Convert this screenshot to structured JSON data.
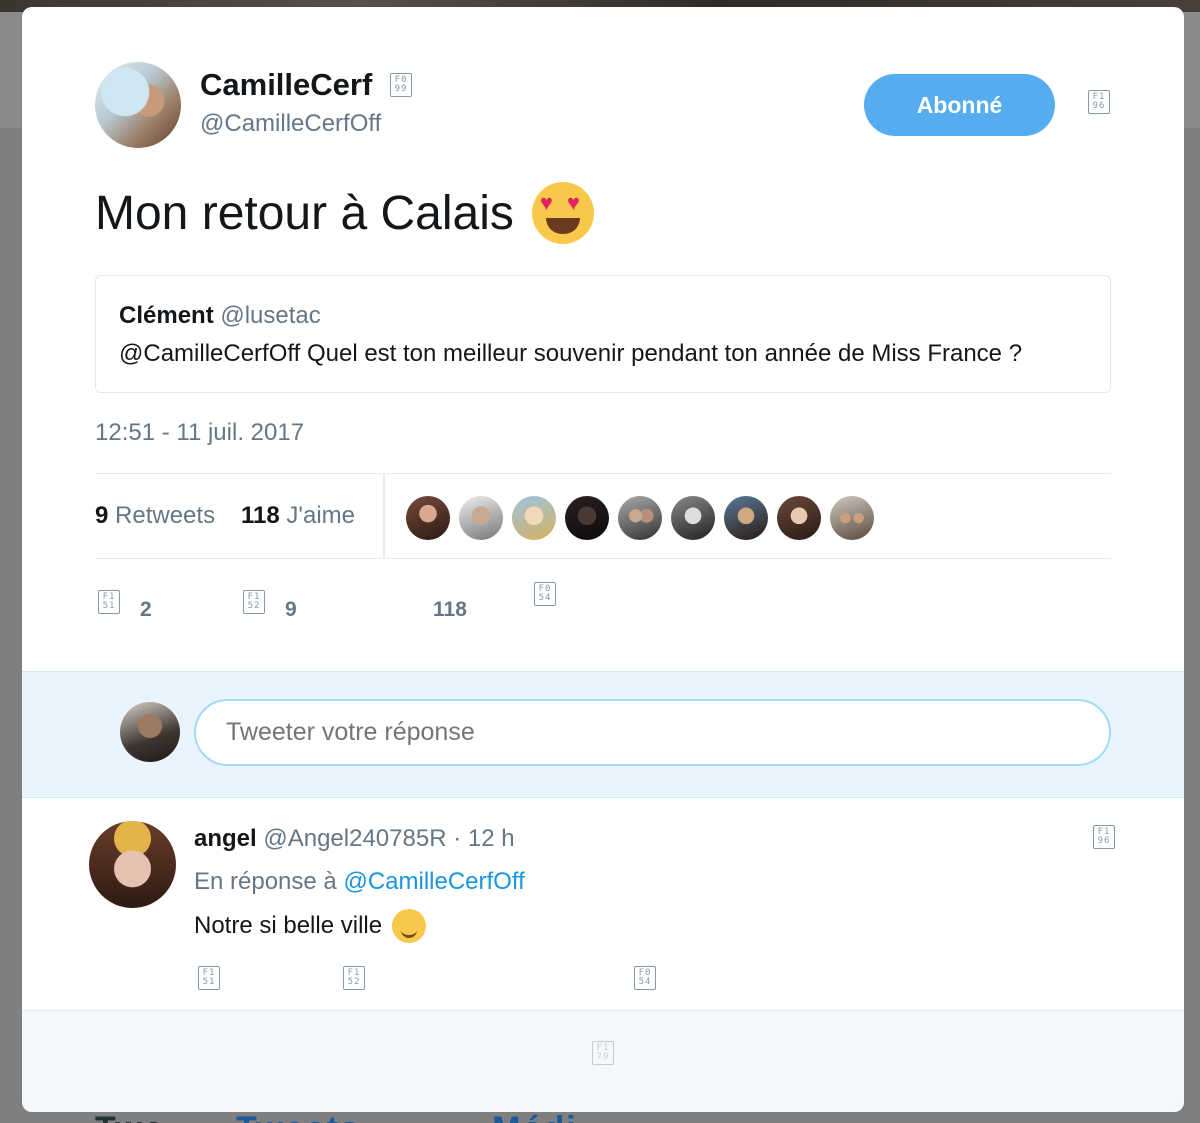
{
  "author": {
    "display_name": "CamilleCerf",
    "screen_name": "@CamilleCerfOff",
    "verified_icon": "verified-badge-icon"
  },
  "follow_button": {
    "label": "Abonné",
    "color": "#55acee"
  },
  "tweet": {
    "text": "Mon retour à Calais",
    "emoji": "heart-eyes-emoji",
    "timestamp": "12:51 - 11 juil. 2017"
  },
  "quote": {
    "author_name": "Clément",
    "author_handle": "@lusetac",
    "text": "@CamilleCerfOff Quel est ton meilleur souvenir pendant ton année de Miss France ?"
  },
  "stats": {
    "retweets_count": "9",
    "retweets_label": "Retweets",
    "likes_count": "118",
    "likes_label": "J'aime",
    "likers": [
      "liker-1",
      "liker-2",
      "liker-3",
      "liker-4",
      "liker-5",
      "liker-6",
      "liker-7",
      "liker-8",
      "liker-9"
    ]
  },
  "actions": {
    "reply_count": "2",
    "retweet_count": "9",
    "like_count": "118"
  },
  "reply_box": {
    "placeholder": "Tweeter votre réponse"
  },
  "reply": {
    "name": "angel",
    "handle": "@Angel240785R",
    "time": "· 12 h",
    "context_prefix": "En réponse à",
    "context_handle": "@CamilleCerfOff",
    "text": "Notre si belle ville",
    "emoji": "wink-emoji"
  },
  "backdrop": {
    "bottom_text_left": "Twe",
    "bottom_text_mid": "Tweets",
    "bottom_text_right": "Médi"
  },
  "colors": {
    "accent": "#55acee",
    "link": "#1b95e0",
    "text": "#14171a",
    "muted": "#657786"
  }
}
